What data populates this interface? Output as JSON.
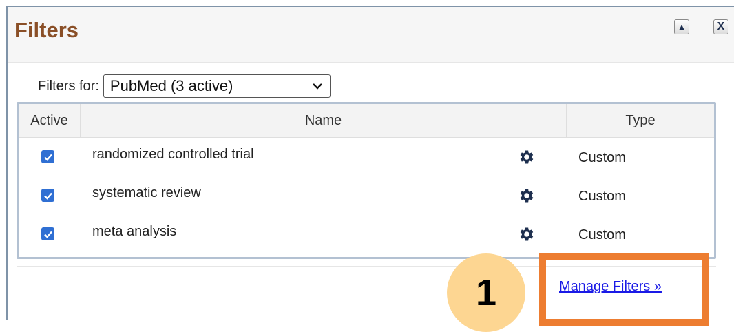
{
  "window": {
    "title": "Filters",
    "collapse_glyph": "▲",
    "close_glyph": "X"
  },
  "filters_for": {
    "label": "Filters for:",
    "selected": "PubMed (3 active)"
  },
  "table": {
    "headers": {
      "active": "Active",
      "name": "Name",
      "type": "Type"
    },
    "rows": [
      {
        "active": true,
        "name": "randomized controlled trial",
        "type": "Custom"
      },
      {
        "active": true,
        "name": "systematic review",
        "type": "Custom"
      },
      {
        "active": true,
        "name": "meta analysis",
        "type": "Custom"
      }
    ]
  },
  "footer": {
    "manage_link": "Manage Filters »"
  },
  "annotation": {
    "step_number": "1",
    "highlight_color": "#ed7d31",
    "badge_color": "#fdd692"
  },
  "colors": {
    "title": "#8a4f27",
    "checkbox": "#2f6fd3",
    "gear": "#1e2f4f",
    "link": "#1a1ae6"
  }
}
